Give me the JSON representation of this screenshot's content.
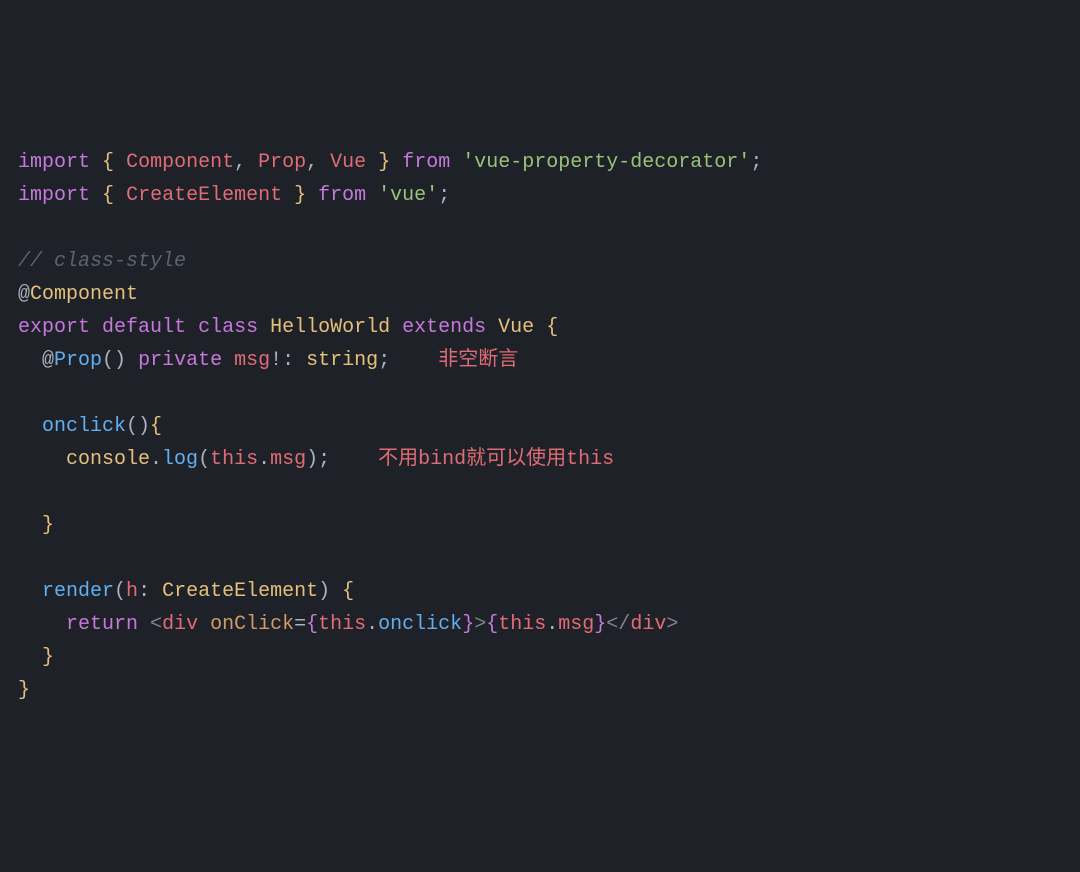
{
  "code": {
    "line1": {
      "import": "import",
      "brace_open": "{",
      "id1": "Component",
      "comma1": ",",
      "id2": "Prop",
      "comma2": ",",
      "id3": "Vue",
      "brace_close": "}",
      "from": "from",
      "str": "'vue-property-decorator'",
      "semi": ";"
    },
    "line2": {
      "import": "import",
      "brace_open": "{",
      "id1": "CreateElement",
      "brace_close": "}",
      "from": "from",
      "str": "'vue'",
      "semi": ";"
    },
    "line4": {
      "comment": "// class-style"
    },
    "line5": {
      "at": "@",
      "decorator": "Component"
    },
    "line6": {
      "export": "export",
      "default": "default",
      "class": "class",
      "name": "HelloWorld",
      "extends": "extends",
      "base": "Vue",
      "brace": "{"
    },
    "line7": {
      "at": "@",
      "decorator": "Prop",
      "parens": "()",
      "private": "private",
      "prop": "msg",
      "bang": "!",
      "colon": ":",
      "type": "string",
      "semi": ";"
    },
    "line9": {
      "method": "onclick",
      "parens": "()",
      "brace": "{"
    },
    "line10": {
      "console": "console",
      "dot1": ".",
      "log": "log",
      "paren_open": "(",
      "this": "this",
      "dot2": ".",
      "msg": "msg",
      "paren_close": ")",
      "semi": ";"
    },
    "line12": {
      "brace": "}"
    },
    "line14": {
      "method": "render",
      "paren_open": "(",
      "param": "h",
      "colon": ":",
      "type": "CreateElement",
      "paren_close": ")",
      "brace": "{"
    },
    "line15": {
      "return": "return",
      "lt1": "<",
      "tag1": "div",
      "attr": "onClick",
      "eq": "=",
      "jb1": "{",
      "this1": "this",
      "dot1": ".",
      "onclick": "onclick",
      "jb2": "}",
      "gt1": ">",
      "jb3": "{",
      "this2": "this",
      "dot2": ".",
      "msg": "msg",
      "jb4": "}",
      "lt2": "</",
      "tag2": "div",
      "gt2": ">"
    },
    "line16": {
      "brace": "}"
    },
    "line17": {
      "brace": "}"
    }
  },
  "annotations": {
    "non_null": "非空断言",
    "no_bind": "不用bind就可以使用this"
  }
}
